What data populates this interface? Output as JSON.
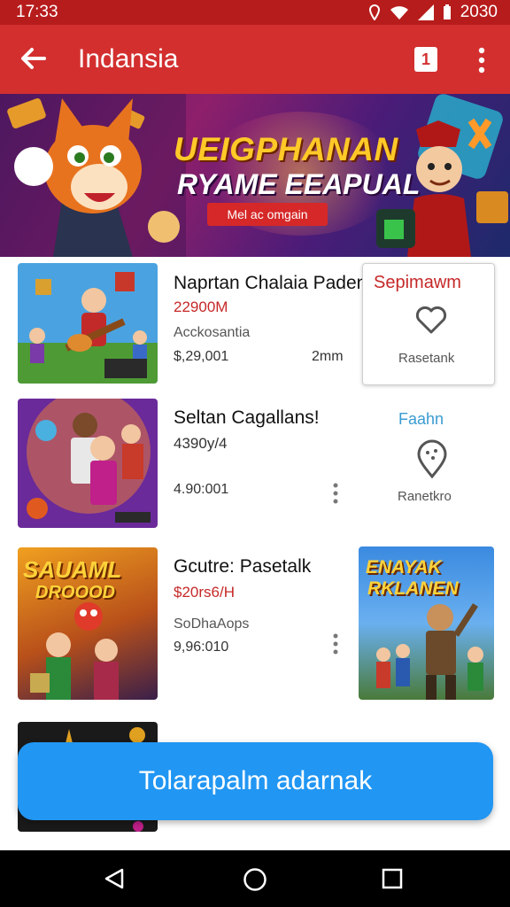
{
  "status": {
    "time": "17:33",
    "battery": "2030"
  },
  "appbar": {
    "title": "Indansia",
    "action_label": "1"
  },
  "banner": {
    "headline": "UEIGPHANAN",
    "subheadline": "RYAME EEAPUAL",
    "pill": "Mel ac omgain"
  },
  "items": [
    {
      "title": "Naprtan Chalaia Padenc",
      "price": "22900M",
      "subtitle": "Acckosantia",
      "number": "$,29,001",
      "meta": "2mm",
      "side_label": "Sepimawm",
      "side_sub": "Rasetank",
      "side_icon": "heart-icon"
    },
    {
      "title": "Seltan Cagallans!",
      "price": "4390y/4",
      "number": "4.90:001",
      "side_label": "Faahn",
      "side_sub": "Ranetkro",
      "side_icon": "location-pin-icon"
    },
    {
      "title": "Gcutre: Pasetalk",
      "price": "$20rs6/H",
      "subtitle": "SoDhaAops",
      "number": "9,96:010",
      "poster_text_1": "ENAYAK",
      "poster_text_2": "RKLANEN",
      "thumb_text_1": "SAUAML",
      "thumb_text_2": "DROOOD"
    }
  ],
  "cta": {
    "label": "Tolarapalm adarnak"
  },
  "colors": {
    "appbar": "#d32f2f",
    "statusbar": "#b71c1c",
    "accent_blue": "#2196f3",
    "price_red": "#c62828"
  }
}
